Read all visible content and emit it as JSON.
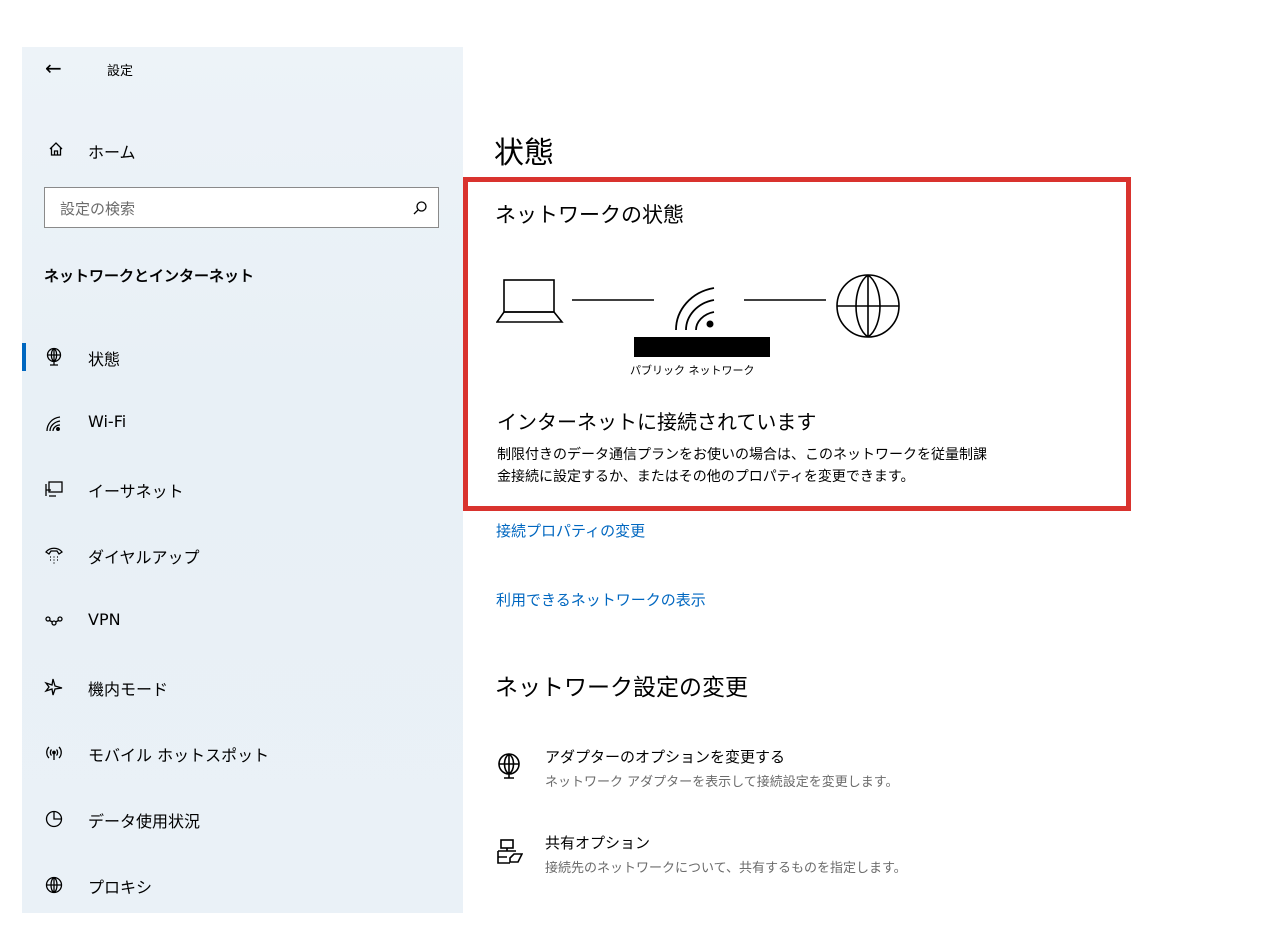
{
  "sidebar": {
    "title": "設定",
    "home": "ホーム",
    "search_placeholder": "設定の検索",
    "section": "ネットワークとインターネット",
    "items": [
      {
        "label": "状態",
        "icon": "globe-stand-icon",
        "active": true
      },
      {
        "label": "Wi-Fi",
        "icon": "wifi-icon"
      },
      {
        "label": "イーサネット",
        "icon": "ethernet-icon"
      },
      {
        "label": "ダイヤルアップ",
        "icon": "dialup-icon"
      },
      {
        "label": "VPN",
        "icon": "vpn-icon"
      },
      {
        "label": "機内モード",
        "icon": "airplane-icon"
      },
      {
        "label": "モバイル ホットスポット",
        "icon": "hotspot-icon"
      },
      {
        "label": "データ使用状況",
        "icon": "data-usage-icon"
      },
      {
        "label": "プロキシ",
        "icon": "globe-icon"
      }
    ]
  },
  "main": {
    "title": "状態",
    "network_heading": "ネットワークの状態",
    "network_type": "パブリック ネットワーク",
    "status": "インターネットに接続されています",
    "description_line1": "制限付きのデータ通信プランをお使いの場合は、このネットワークを従量制課",
    "description_line2": "金接続に設定するか、またはその他のプロパティを変更できます。",
    "links": [
      "接続プロパティの変更",
      "利用できるネットワークの表示"
    ],
    "change_heading": "ネットワーク設定の変更",
    "options": [
      {
        "title": "アダプターのオプションを変更する",
        "desc": "ネットワーク アダプターを表示して接続設定を変更します。",
        "icon": "adapter-icon"
      },
      {
        "title": "共有オプション",
        "desc": "接続先のネットワークについて、共有するものを指定します。",
        "icon": "sharing-icon"
      }
    ]
  },
  "colors": {
    "accent": "#0067c0",
    "highlight_border": "#d9332e",
    "sidebar_bg": "#ebf2f8"
  }
}
